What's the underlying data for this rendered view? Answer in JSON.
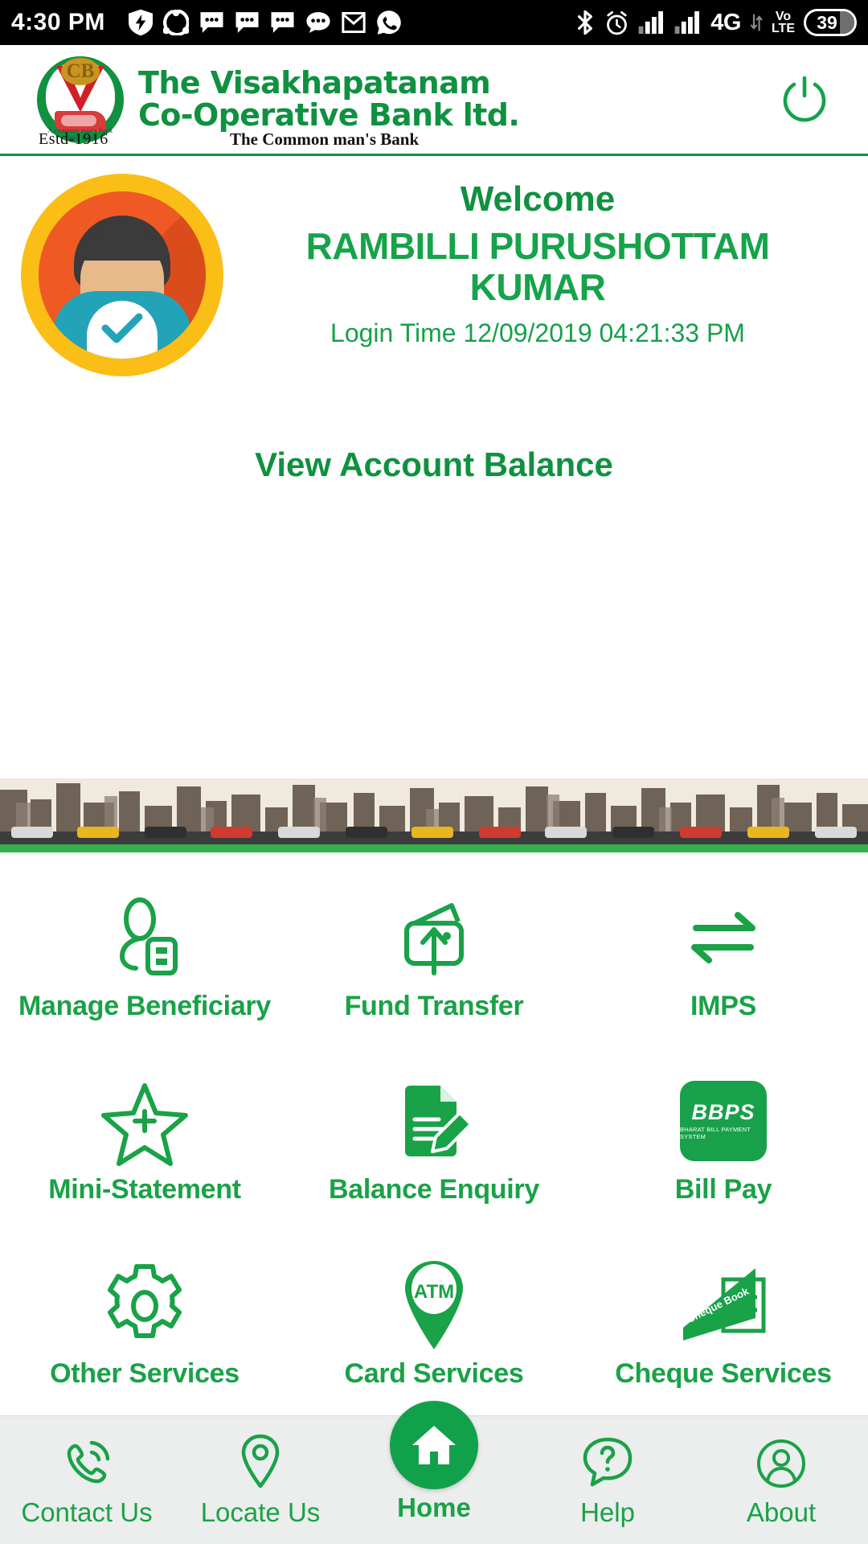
{
  "status_bar": {
    "time": "4:30 PM",
    "left_icons": [
      "shield-bolt-icon",
      "share-icon",
      "message-icon",
      "message-icon",
      "message-icon",
      "chat-bubble-icon",
      "gmail-icon",
      "whatsapp-icon"
    ],
    "right_icons": [
      "bluetooth-icon",
      "alarm-icon",
      "signal-icon",
      "signal-icon"
    ],
    "network": "4G",
    "volte_top": "Vo",
    "volte_bottom": "LTE",
    "battery": "39"
  },
  "header": {
    "bank_name_line1": "The Visakhapatanam",
    "bank_name_line2": "Co-Operative Bank ltd.",
    "established": "Estd-1916",
    "tagline": "The Common man's Bank",
    "logo_monogram": "CB",
    "logo_arc_text": "A common man's bank since 1916",
    "power_icon": "power-icon",
    "brand_green": "#0f9140"
  },
  "welcome": {
    "greeting": "Welcome",
    "user_name": "RAMBILLI PURUSHOTTAM KUMAR",
    "login_time": "Login Time 12/09/2019 04:21:33 PM",
    "view_balance": "View Account Balance"
  },
  "services": [
    {
      "label": "Manage Beneficiary",
      "icon": "manage-beneficiary-icon"
    },
    {
      "label": "Fund Transfer",
      "icon": "fund-transfer-icon"
    },
    {
      "label": "IMPS",
      "icon": "imps-transfer-arrows-icon"
    },
    {
      "label": "Mini-Statement",
      "icon": "star-plus-icon"
    },
    {
      "label": "Balance Enquiry",
      "icon": "document-pencil-icon"
    },
    {
      "label": "Bill Pay",
      "icon": "bbps-logo-icon"
    },
    {
      "label": "Other Services",
      "icon": "gear-icon"
    },
    {
      "label": "Card Services",
      "icon": "atm-map-pin-icon"
    },
    {
      "label": "Cheque Services",
      "icon": "cheque-book-icon"
    }
  ],
  "bbps_logo": {
    "wordmark": "BBPS",
    "subtitle": "BHARAT BILL PAYMENT SYSTEM"
  },
  "bottom_nav": [
    {
      "label": "Contact Us",
      "icon": "phone-call-icon",
      "active": false
    },
    {
      "label": "Locate Us",
      "icon": "map-pin-icon",
      "active": false
    },
    {
      "label": "Home",
      "icon": "home-icon",
      "active": true
    },
    {
      "label": "Help",
      "icon": "question-bubble-icon",
      "active": false
    },
    {
      "label": "About",
      "icon": "person-circle-icon",
      "active": false
    }
  ]
}
